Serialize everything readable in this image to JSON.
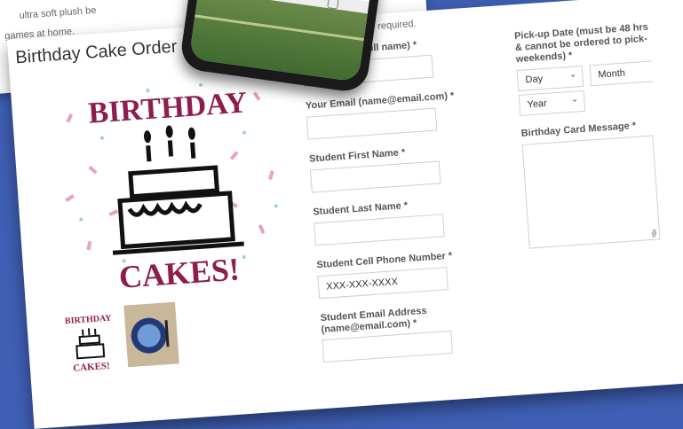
{
  "background_text": {
    "line1": "ultra soft plush be",
    "line2": "games at home."
  },
  "form": {
    "title": "Birthday Cake Order",
    "required_note": "*sk are required.",
    "name_label": "ull name) *",
    "email_label": "Your Email (name@email.com) *",
    "first_name_label": "Student First Name *",
    "last_name_label": "Student Last Name *",
    "phone_label": "Student Cell Phone Number *",
    "phone_placeholder": "XXX-XXX-XXXX",
    "student_email_label_1": "Student Email Address",
    "student_email_label_2": "(name@email.com) *",
    "pickup_label_1": "Pick-up Date (must be 48 hrs",
    "pickup_label_2": "& cannot be ordered to pick-",
    "pickup_label_3": "weekends) *",
    "day_value": "Day",
    "month_value": "Month",
    "year_value": "Year",
    "card_message_label": "Birthday Card Message *"
  },
  "hero": {
    "line1": "BIRTHDAY",
    "line2": "CAKES!",
    "thumb_line1": "BIRTHDAY",
    "thumb_line2": "CAKES!"
  },
  "colors": {
    "brand": "#8e1c4f",
    "background": "#3f5fb4"
  }
}
